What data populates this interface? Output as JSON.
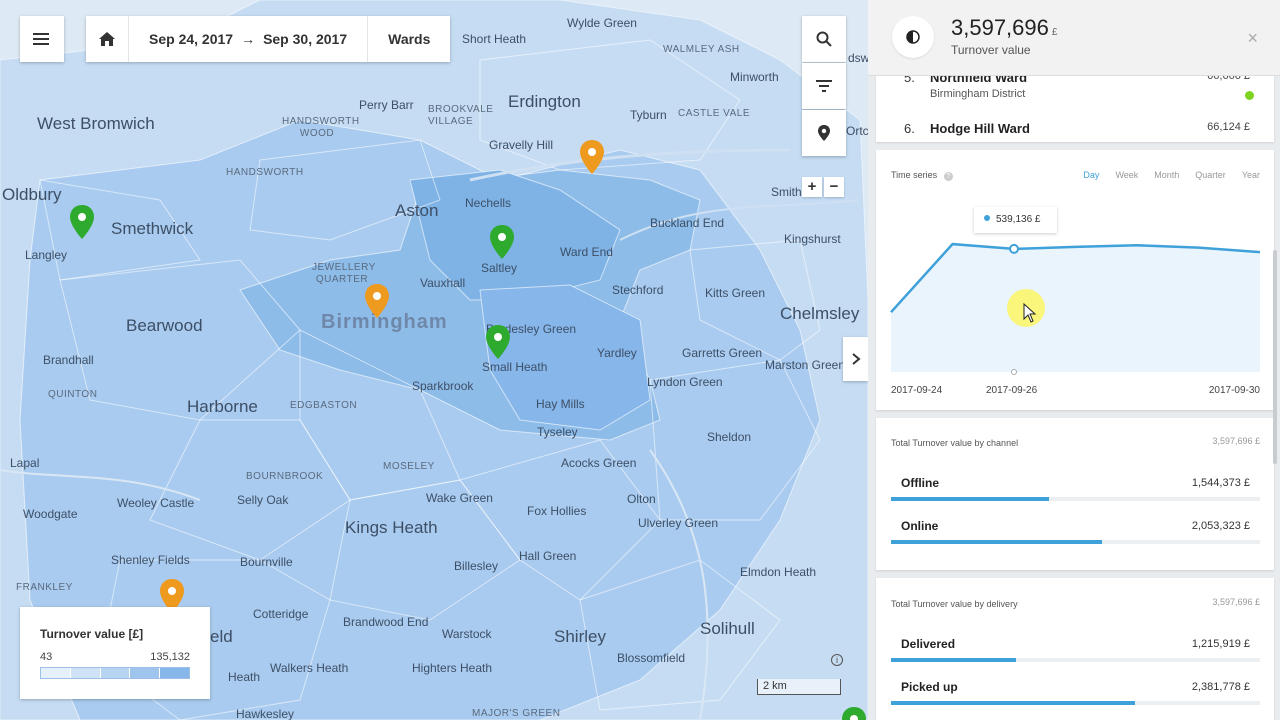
{
  "toolbar": {
    "menu_icon": "hamburger-icon",
    "home_icon": "home-icon",
    "date_from": "Sep 24, 2017",
    "date_to": "Sep 30, 2017",
    "arrow": "→",
    "level": "Wards"
  },
  "map_tools": {
    "search_icon": "search-icon",
    "filter_icon": "filter-icon",
    "location_icon": "location-pin-icon",
    "zoom_in": "+",
    "zoom_out": "−",
    "collapse_icon": "chevron-right-icon"
  },
  "places": [
    {
      "name": "West Bromwich",
      "size": "big"
    },
    {
      "name": "Oldbury",
      "size": "big"
    },
    {
      "name": "Smethwick",
      "size": "big"
    },
    {
      "name": "Langley",
      "size": "small"
    },
    {
      "name": "Perry Barr",
      "size": "small"
    },
    {
      "name": "Brookvale Village",
      "size": "caps"
    },
    {
      "name": "Handsworth Wood",
      "size": "caps"
    },
    {
      "name": "Handsworth",
      "size": "caps"
    },
    {
      "name": "Erdington",
      "size": "big"
    },
    {
      "name": "Wylde Green",
      "size": "small"
    },
    {
      "name": "Short Heath",
      "size": "small"
    },
    {
      "name": "Walmley Ash",
      "size": "caps"
    },
    {
      "name": "Minworth",
      "size": "small"
    },
    {
      "name": "Tyburn",
      "size": "small"
    },
    {
      "name": "Castle Vale",
      "size": "caps"
    },
    {
      "name": "Gravelly Hill",
      "size": "small"
    },
    {
      "name": "Aston",
      "size": "big"
    },
    {
      "name": "Nechells",
      "size": "small"
    },
    {
      "name": "Buckland End",
      "size": "small"
    },
    {
      "name": "Smith",
      "size": "small"
    },
    {
      "name": "Kingshurst",
      "size": "small"
    },
    {
      "name": "Jewellery Quarter",
      "size": "caps"
    },
    {
      "name": "Vauxhall",
      "size": "small"
    },
    {
      "name": "Saltley",
      "size": "small"
    },
    {
      "name": "Ward End",
      "size": "small"
    },
    {
      "name": "Stechford",
      "size": "small"
    },
    {
      "name": "Kitts Green",
      "size": "small"
    },
    {
      "name": "Chelmsley",
      "size": "big"
    },
    {
      "name": "Bearwood",
      "size": "big"
    },
    {
      "name": "Birmingham",
      "size": "city"
    },
    {
      "name": "Bordesley Green",
      "size": "small"
    },
    {
      "name": "Small Heath",
      "size": "small"
    },
    {
      "name": "Yardley",
      "size": "small"
    },
    {
      "name": "Garretts Green",
      "size": "small"
    },
    {
      "name": "Marston Green",
      "size": "small"
    },
    {
      "name": "Brandhall",
      "size": "small"
    },
    {
      "name": "Sparkbrook",
      "size": "small"
    },
    {
      "name": "Lyndon Green",
      "size": "small"
    },
    {
      "name": "Quinton",
      "size": "caps"
    },
    {
      "name": "Harborne",
      "size": "big"
    },
    {
      "name": "Edgbaston",
      "size": "caps"
    },
    {
      "name": "Hay Mills",
      "size": "small"
    },
    {
      "name": "Tyseley",
      "size": "small"
    },
    {
      "name": "Sheldon",
      "size": "small"
    },
    {
      "name": "Lapal",
      "size": "small"
    },
    {
      "name": "Acocks Green",
      "size": "small"
    },
    {
      "name": "Moseley",
      "size": "caps"
    },
    {
      "name": "Bournbrook",
      "size": "caps"
    },
    {
      "name": "Selly Oak",
      "size": "small"
    },
    {
      "name": "Wake Green",
      "size": "small"
    },
    {
      "name": "Olton",
      "size": "small"
    },
    {
      "name": "Woodgate",
      "size": "small"
    },
    {
      "name": "Weoley Castle",
      "size": "small"
    },
    {
      "name": "Fox Hollies",
      "size": "small"
    },
    {
      "name": "Ulverley Green",
      "size": "small"
    },
    {
      "name": "Kings Heath",
      "size": "big"
    },
    {
      "name": "Shenley Fields",
      "size": "small"
    },
    {
      "name": "Bournville",
      "size": "small"
    },
    {
      "name": "Billesley",
      "size": "small"
    },
    {
      "name": "Hall Green",
      "size": "small"
    },
    {
      "name": "Elmdon Heath",
      "size": "small"
    },
    {
      "name": "Frankley",
      "size": "caps"
    },
    {
      "name": "Cotteridge",
      "size": "small"
    },
    {
      "name": "Brandwood End",
      "size": "small"
    },
    {
      "name": "Shirley",
      "size": "big"
    },
    {
      "name": "Solihull",
      "size": "big"
    },
    {
      "name": "Warstock",
      "size": "small"
    },
    {
      "name": "Walkers Heath",
      "size": "small"
    },
    {
      "name": "Highters Heath",
      "size": "small"
    },
    {
      "name": "Blossomfield",
      "size": "small"
    },
    {
      "name": "Hawkesley",
      "size": "small"
    },
    {
      "name": "Major's Green",
      "size": "caps"
    },
    {
      "name": "Heath",
      "size": "small"
    },
    {
      "name": "Ortc",
      "size": "small"
    },
    {
      "name": "dsw",
      "size": "small"
    },
    {
      "name": "eld",
      "size": "big"
    }
  ],
  "legend": {
    "title": "Turnover value [£]",
    "min": "43",
    "max": "135,132",
    "colors": [
      "#e6f0fb",
      "#cfe2f7",
      "#b7d4f2",
      "#9fc5ee",
      "#86b6ea"
    ]
  },
  "scale_label": "2 km",
  "panel": {
    "header": {
      "value": "3,597,696",
      "currency": "£",
      "label": "Turnover value",
      "icon": "contrast-icon",
      "close": "×"
    },
    "ranking": [
      {
        "rank": "5.",
        "name": "Northfield Ward",
        "district": "Birmingham District",
        "value": "66,666 £",
        "status_color": "#7ed321"
      },
      {
        "rank": "6.",
        "name": "Hodge Hill Ward",
        "value": "66,124 £"
      }
    ],
    "time_series": {
      "title": "Time series",
      "help_icon": "help-icon",
      "tabs": [
        "Day",
        "Week",
        "Month",
        "Quarter",
        "Year"
      ],
      "active_tab": "Day",
      "tooltip": "539,136 £",
      "x_labels": [
        "2017-09-24",
        "2017-09-26",
        "2017-09-30"
      ]
    },
    "channel": {
      "title": "Total Turnover value by channel",
      "total": "3,597,696 £",
      "items": [
        {
          "name": "Offline",
          "value": "1,544,373 £",
          "share": 0.429
        },
        {
          "name": "Online",
          "value": "2,053,323 £",
          "share": 0.571
        }
      ]
    },
    "delivery": {
      "title": "Total Turnover value by delivery",
      "total": "3,597,696 £",
      "items": [
        {
          "name": "Delivered",
          "value": "1,215,919 £",
          "share": 0.338
        },
        {
          "name": "Picked up",
          "value": "2,381,778 £",
          "share": 0.662
        }
      ]
    }
  },
  "chart_data": {
    "type": "area",
    "x": [
      "2017-09-24",
      "2017-09-25",
      "2017-09-26",
      "2017-09-27",
      "2017-09-28",
      "2017-09-29",
      "2017-09-30"
    ],
    "values": [
      262000,
      560000,
      539136,
      548000,
      555000,
      545000,
      525000
    ],
    "title": "Time series",
    "color": "#3ea1d9"
  }
}
